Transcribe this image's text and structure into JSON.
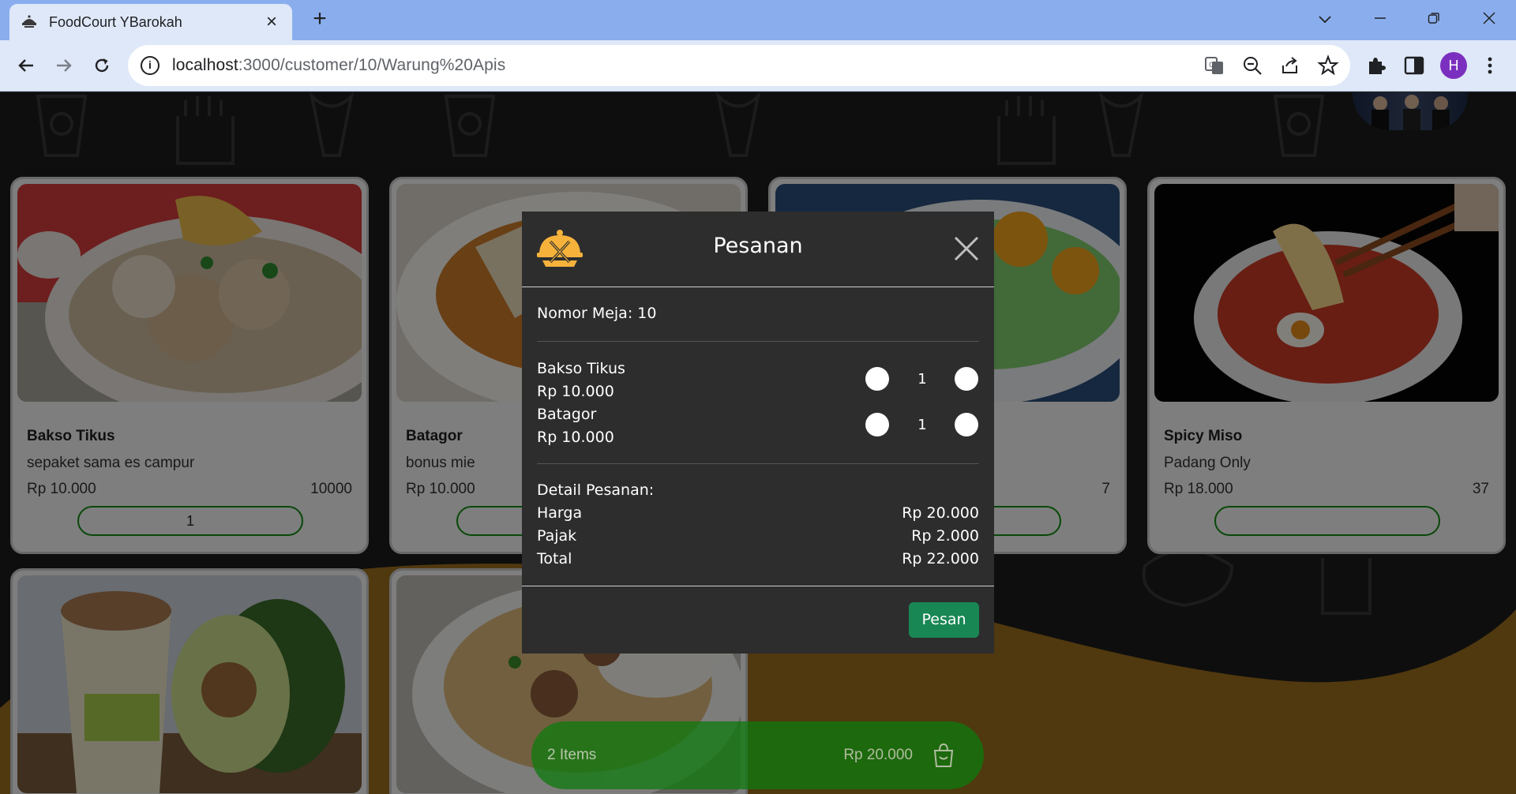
{
  "browser": {
    "tab_title": "FoodCourt YBarokah",
    "url_host": "localhost",
    "url_rest": ":3000/customer/10/Warung%20Apis",
    "profile_initial": "H"
  },
  "menu": [
    {
      "name": "Bakso Tikus",
      "desc": "sepaket sama es campur",
      "price": "Rp 10.000",
      "stock": "10000",
      "qty": "1"
    },
    {
      "name": "Batagor",
      "desc": "bonus mie",
      "price": "Rp 10.000",
      "stock": "",
      "qty": ""
    },
    {
      "name": "",
      "desc": "",
      "price": "",
      "stock": "7",
      "qty": ""
    },
    {
      "name": "Spicy Miso",
      "desc": "Padang Only",
      "price": "Rp 18.000",
      "stock": "37",
      "qty": ""
    }
  ],
  "cart": {
    "items": "2 Items",
    "total": "Rp 20.000"
  },
  "modal": {
    "title": "Pesanan",
    "table_label": "Nomor Meja: 10",
    "orders": [
      {
        "name": "Bakso Tikus",
        "price": "Rp 10.000",
        "qty": "1"
      },
      {
        "name": "Batagor",
        "price": "Rp 10.000",
        "qty": "1"
      }
    ],
    "detail_label": "Detail Pesanan:",
    "summary": [
      {
        "label": "Harga",
        "value": "Rp 20.000"
      },
      {
        "label": "Pajak",
        "value": "Rp 2.000"
      },
      {
        "label": "Total",
        "value": "Rp 22.000"
      }
    ],
    "submit_label": "Pesan"
  },
  "colors": {
    "wave": "#9a6b1e",
    "modal_bg": "#2d2d2d",
    "submit": "#198754",
    "cart": "#0d7a0d"
  }
}
